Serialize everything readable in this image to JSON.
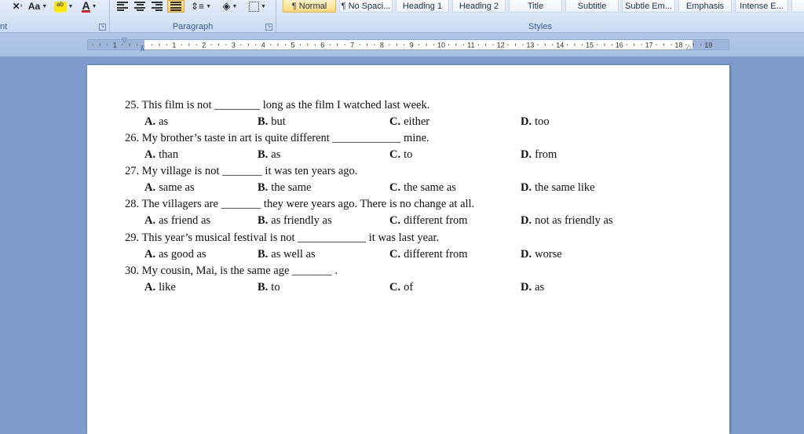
{
  "ribbon": {
    "font_group_label": "nt",
    "paragraph_group_label": "Paragraph",
    "styles_group_label": "Styles",
    "font_tools": {
      "clear_format_icon": "x-with-superscript",
      "change_case_label": "Aa",
      "highlight_icon": "ab-highlighter",
      "font_color_label": "A",
      "font_color_accent": "#e02020",
      "highlight_accent": "#ffe600"
    },
    "paragraph_tools": [
      "align-left-icon",
      "align-center-icon",
      "align-right-icon",
      "justify-icon",
      "line-spacing-icon",
      "shading-icon",
      "borders-icon"
    ],
    "styles": [
      {
        "label": "¶ Normal",
        "active": true
      },
      {
        "label": "¶ No Spaci...",
        "active": false
      },
      {
        "label": "Heading 1",
        "active": false
      },
      {
        "label": "Heading 2",
        "active": false
      },
      {
        "label": "Title",
        "active": false
      },
      {
        "label": "Subtitle",
        "active": false
      },
      {
        "label": "Subtle Em...",
        "active": false
      },
      {
        "label": "Emphasis",
        "active": false
      },
      {
        "label": "Intense E...",
        "active": false
      }
    ]
  },
  "ruler": {
    "left_numbers": [
      "2",
      "1"
    ],
    "numbers": [
      "1",
      "2",
      "3",
      "4",
      "5",
      "6",
      "7",
      "8",
      "9",
      "10",
      "11",
      "12",
      "13",
      "14",
      "15",
      "16",
      "17",
      "18",
      "19"
    ]
  },
  "document": {
    "questions": [
      {
        "text": "25. This film is not ________ long as the film I watched last week.",
        "options": [
          {
            "letter": "A.",
            "text": "as"
          },
          {
            "letter": "B.",
            "text": "but"
          },
          {
            "letter": "C.",
            "text": "either"
          },
          {
            "letter": "D.",
            "text": "too"
          }
        ]
      },
      {
        "text": "26. My brother’s taste in art is quite different ____________ mine.",
        "options": [
          {
            "letter": "A.",
            "text": "than"
          },
          {
            "letter": "B.",
            "text": "as"
          },
          {
            "letter": "C.",
            "text": "to"
          },
          {
            "letter": "D.",
            "text": "from"
          }
        ]
      },
      {
        "text": "27. My village is not _______ it was ten years ago.",
        "options": [
          {
            "letter": "A.",
            "text": "same as"
          },
          {
            "letter": "B.",
            "text": "the same"
          },
          {
            "letter": "C.",
            "text": "the same as"
          },
          {
            "letter": "D.",
            "text": "the same like"
          }
        ]
      },
      {
        "text": "28. The villagers are _______ they were years ago. There is no change at all.",
        "options": [
          {
            "letter": "A.",
            "text": "as friend as"
          },
          {
            "letter": "B.",
            "text": "as friendly as"
          },
          {
            "letter": "C.",
            "text": "different from"
          },
          {
            "letter": "D.",
            "text": "not as friendly as"
          }
        ]
      },
      {
        "text": "29. This year’s musical festival is not ____________ it was last year.",
        "options": [
          {
            "letter": "A.",
            "text": "as good as"
          },
          {
            "letter": "B.",
            "text": "as well as"
          },
          {
            "letter": "C.",
            "text": "different from"
          },
          {
            "letter": "D.",
            "text": "worse"
          }
        ]
      },
      {
        "text": "30. My cousin, Mai, is the same age _______ .",
        "options": [
          {
            "letter": "A.",
            "text": "like"
          },
          {
            "letter": "B.",
            "text": "to"
          },
          {
            "letter": "C.",
            "text": "of"
          },
          {
            "letter": "D.",
            "text": "as"
          }
        ]
      }
    ]
  },
  "colors": {
    "app_background": "#7d9ccb",
    "ribbon_label": "#3b5a8c",
    "active_style": "#ffd97a"
  }
}
